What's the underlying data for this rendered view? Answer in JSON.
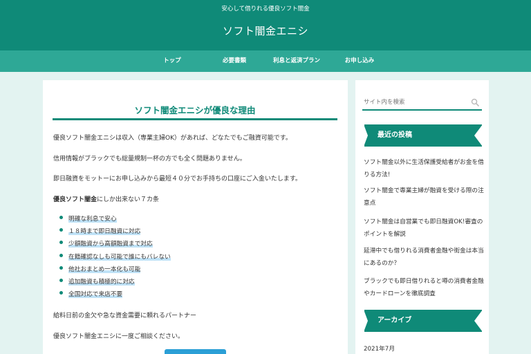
{
  "header": {
    "tagline": "安心して借りれる優良ソフト闇金",
    "site_title": "ソフト闇金エニシ"
  },
  "nav": {
    "items": [
      "トップ",
      "必要書類",
      "利息と返済プラン",
      "お申し込み"
    ]
  },
  "article": {
    "title": "ソフト闇金エニシが優良な理由",
    "paragraphs": [
      "優良ソフト闇金エニシは収入（専業主婦OK）があれば、どなたでもご融資可能です。",
      "信用情報がブラックでも総量規制一杯の方でも全く問題ありません。",
      "即日融資をモットーにお申し込みから最短４０分でお手持ちの口座にご入金いたします。"
    ],
    "reasons_bold": "優良ソフト闇金",
    "reasons_rest": "にしか出来ない７カ条",
    "list": [
      "明確な利息で安心",
      "１８時まで即日融資に対応",
      "少額融資から高額融資まで対応",
      "在籍確認なしも可能で誰にもバレない",
      "他社おまとめ一本化も可能",
      "追加融資も積極的に対応",
      "全国対応で来店不要"
    ],
    "closing1": "給料日前の金欠や急な資金需要に頼れるパートナー",
    "closing2": "優良ソフト闇金エニシに一度ご相談ください。"
  },
  "sidebar": {
    "search_placeholder": "サイト内を検索",
    "recent_heading": "最近の投稿",
    "recent_posts": [
      "ソフト闇金以外に生活保護受給者がお金を借りる方法!",
      "ソフト闇金で専業主婦が融資を受ける際の注意点",
      "ソフト闇金は自営業でも即日融資OK!審査のポイントを解説",
      "延滞中でも借りれる消費者金融や街金は本当にあるのか？",
      "ブラックでも即日借りれると噂の消費者金融やカードローンを徹底調査"
    ],
    "archive_heading": "アーカイブ",
    "archive_items": [
      "2021年7月"
    ]
  },
  "colors": {
    "primary": "#0f8a78",
    "nav": "#2ea896",
    "background": "#e3f3f1",
    "highlight": "#bfe2f7",
    "cta": "#2b9fd6"
  }
}
